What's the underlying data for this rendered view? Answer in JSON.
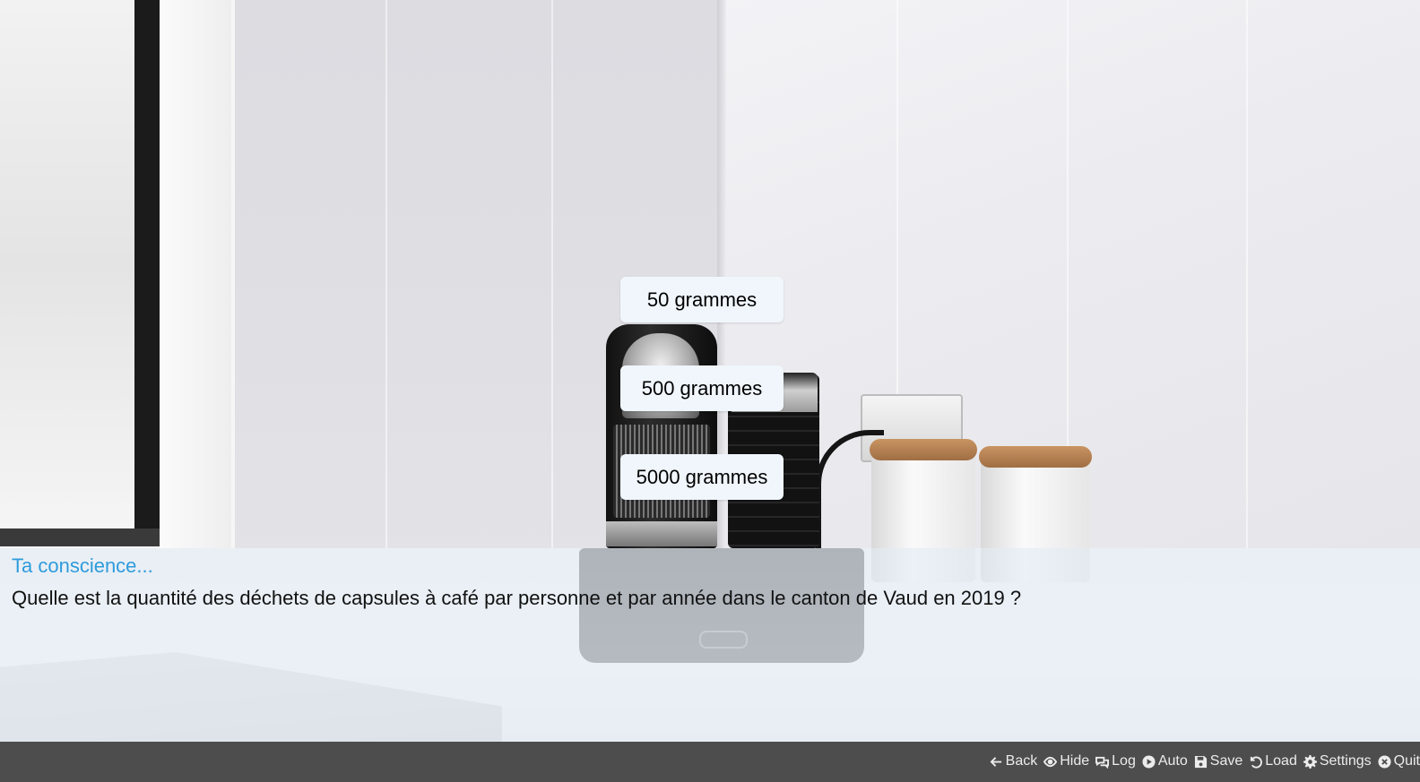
{
  "choices": [
    {
      "label": "50 grammes"
    },
    {
      "label": "500 grammes"
    },
    {
      "label": "5000 grammes"
    }
  ],
  "dialogue": {
    "speaker": "Ta conscience...",
    "text": "Quelle est la quantité des déchets de capsules à café par personne et par année dans le canton de Vaud en 2019 ?"
  },
  "quick_menu": {
    "items": [
      {
        "label": "Back",
        "icon": "arrow-left-icon"
      },
      {
        "label": "Hide",
        "icon": "eye-icon"
      },
      {
        "label": "Log",
        "icon": "chat-bubbles-icon"
      },
      {
        "label": "Auto",
        "icon": "play-circle-icon"
      },
      {
        "label": "Save",
        "icon": "floppy-disk-icon"
      },
      {
        "label": "Load",
        "icon": "undo-icon"
      },
      {
        "label": "Settings",
        "icon": "gear-icon"
      },
      {
        "label": "Quit",
        "icon": "close-circle-icon"
      }
    ]
  },
  "colors": {
    "speaker": "#2e9bdc",
    "choice_bg": "#f0f6fc",
    "textbox_bg": "#e2ecf5",
    "quickmenu_bg": "#4d4d4d"
  }
}
